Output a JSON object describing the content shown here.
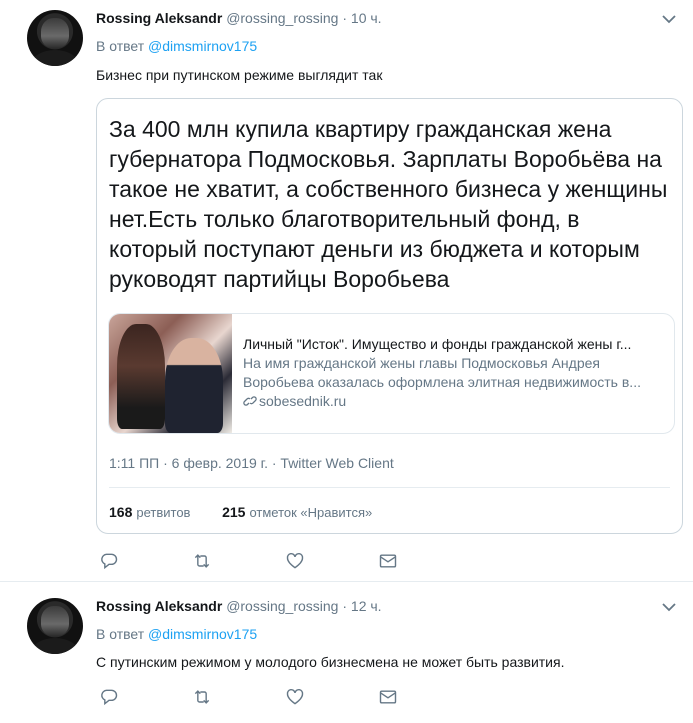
{
  "tweets": [
    {
      "name": "Rossing Aleksandr",
      "handle": "@rossing_rossing",
      "dot": "·",
      "time": "10 ч.",
      "reply_prefix": "В ответ",
      "reply_to": "@dimsmirnov175",
      "text": "Бизнес при путинском режиме выглядит так",
      "quote": {
        "text": "За 400 млн купила квартиру гражданская жена губернатора Подмосковья. Зарплаты Воробьёва на такое не хватит, а собственного бизнеса у женщины нет.Есть только благотворительный фонд, в который поступают деньги из бюджета и которым руководят партийцы Воробьева",
        "card": {
          "title": "Личный \"Исток\". Имущество и фонды гражданской жены г...",
          "description": "На имя гражданской жены главы Подмосковья Андрея Воробьева оказалась оформлена элитная недвижимость в...",
          "link": "sobesednik.ru",
          "link_icon": "link-icon"
        },
        "meta": "1:11 ПП · 6 февр. 2019 г. · Twitter Web Client",
        "retweets_count": "168",
        "retweets_label": "ретвитов",
        "likes_count": "215",
        "likes_label": "отметок «Нравится»"
      }
    },
    {
      "name": "Rossing Aleksandr",
      "handle": "@rossing_rossing",
      "dot": "·",
      "time": "12 ч.",
      "reply_prefix": "В ответ",
      "reply_to": "@dimsmirnov175",
      "text": "С путинским режимом у молодого бизнесмена не может быть развития."
    }
  ],
  "icons": {
    "reply": "reply-icon",
    "retweet": "retweet-icon",
    "like": "heart-icon",
    "dm": "envelope-icon",
    "caret": "chevron-down-icon"
  },
  "colors": {
    "link": "#1da1f2",
    "secondary": "#657786",
    "border": "#e6ecf0"
  }
}
